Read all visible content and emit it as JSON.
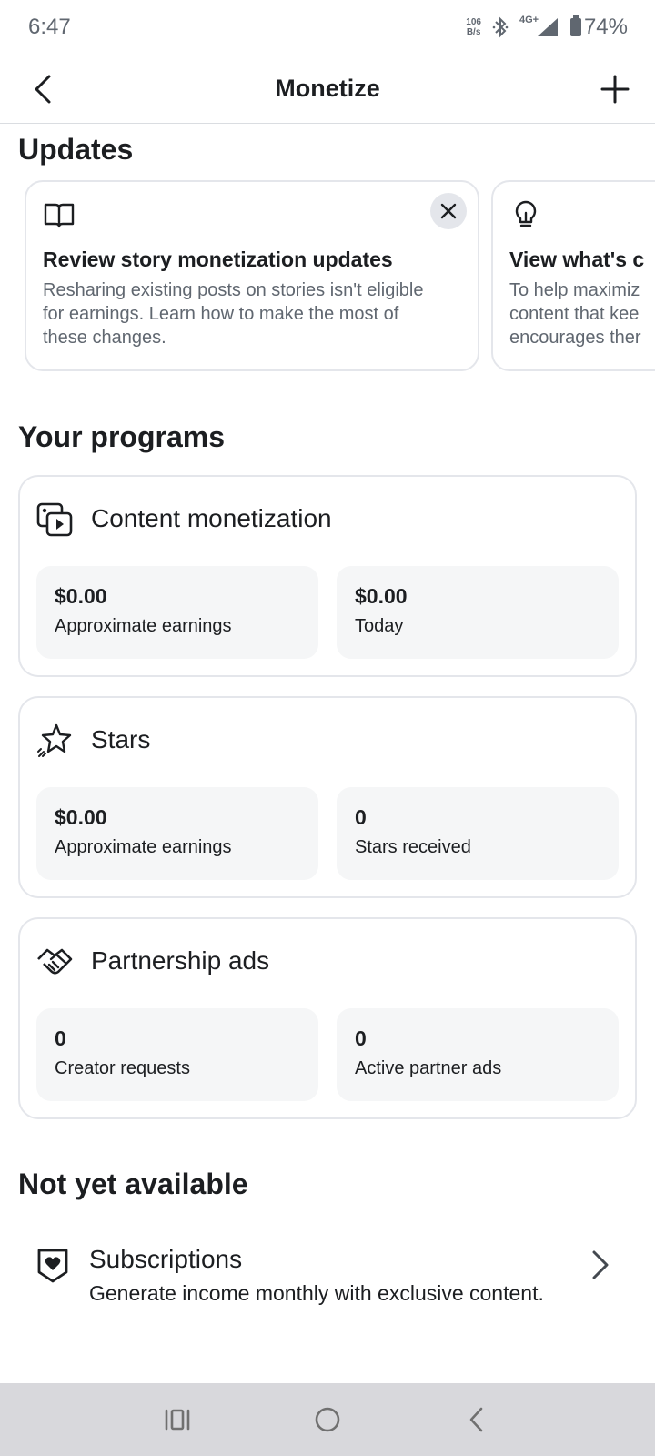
{
  "status_bar": {
    "time": "6:47",
    "net_speed_top": "106",
    "net_speed_bottom": "B/s",
    "network": "4G+",
    "battery": "74%"
  },
  "header": {
    "title": "Monetize"
  },
  "updates": {
    "heading": "Updates",
    "cards": [
      {
        "title": "Review story monetization updates",
        "body": "Resharing existing posts on stories isn't eligible for earnings. Learn how to make the most of these changes."
      },
      {
        "title": "View what's c",
        "body": "To help maximiz content that kee encourages ther"
      }
    ]
  },
  "programs": {
    "heading": "Your programs",
    "items": [
      {
        "title": "Content monetization",
        "stats": [
          {
            "value": "$0.00",
            "label": "Approximate earnings"
          },
          {
            "value": "$0.00",
            "label": "Today"
          }
        ]
      },
      {
        "title": "Stars",
        "stats": [
          {
            "value": "$0.00",
            "label": "Approximate earnings"
          },
          {
            "value": "0",
            "label": "Stars received"
          }
        ]
      },
      {
        "title": "Partnership ads",
        "stats": [
          {
            "value": "0",
            "label": "Creator requests"
          },
          {
            "value": "0",
            "label": "Active partner ads"
          }
        ]
      }
    ]
  },
  "not_available": {
    "heading": "Not yet available",
    "subscriptions": {
      "title": "Subscriptions",
      "description": "Generate income monthly with exclusive content."
    }
  }
}
